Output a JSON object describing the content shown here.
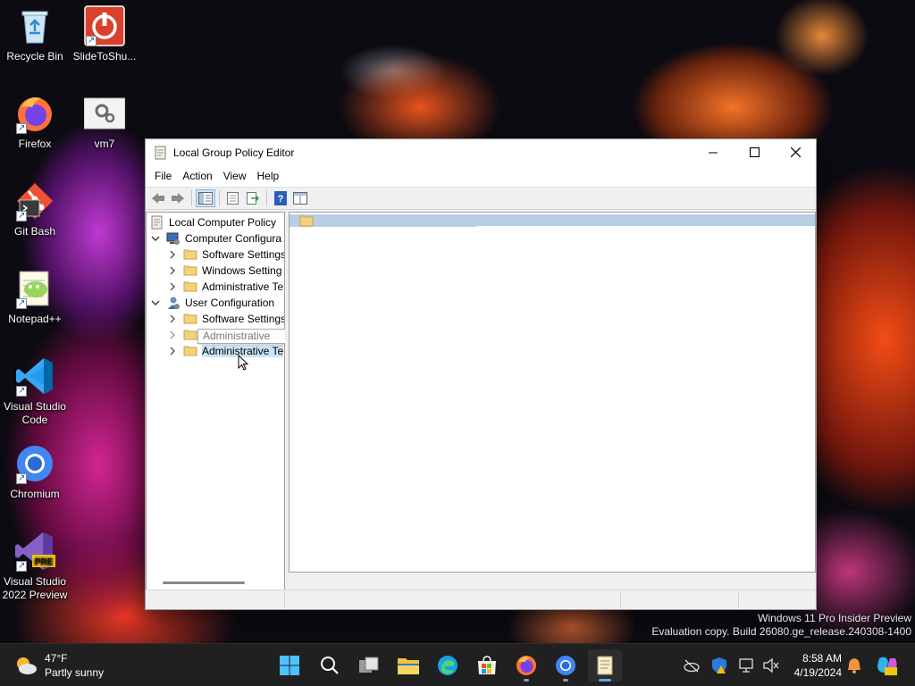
{
  "desktop": {
    "icons": [
      {
        "label": "Recycle Bin"
      },
      {
        "label": "SlideToShu..."
      },
      {
        "label": "Firefox"
      },
      {
        "label": "vm7"
      },
      {
        "label": "Git Bash"
      },
      {
        "label": "Notepad++"
      },
      {
        "label": "Visual Studio Code"
      },
      {
        "label": "Chromium"
      },
      {
        "label": "Visual Studio 2022 Preview"
      }
    ],
    "preview_badge": "PRE"
  },
  "window": {
    "title": "Local Group Policy Editor",
    "menu": [
      "File",
      "Action",
      "View",
      "Help"
    ],
    "tree": {
      "root": "Local Computer Policy",
      "computer_config": "Computer Configura",
      "cc_software": "Software Settings",
      "cc_windows": "Windows Setting",
      "cc_admin": "Administrative Te",
      "user_config": "User Configuration",
      "uc_software": "Software Settings",
      "uc_admin_rename": "Administrative",
      "uc_admin": "Administrative Te"
    }
  },
  "watermark": {
    "line1": "Windows 11 Pro Insider Preview",
    "line2": "Evaluation copy. Build 26080.ge_release.240308-1400"
  },
  "taskbar": {
    "weather_temp": "47°F",
    "weather_desc": "Partly sunny",
    "time": "8:58 AM",
    "date": "4/19/2024",
    "colors": {
      "accent": "#5ea4e6",
      "background": "#202020"
    }
  }
}
